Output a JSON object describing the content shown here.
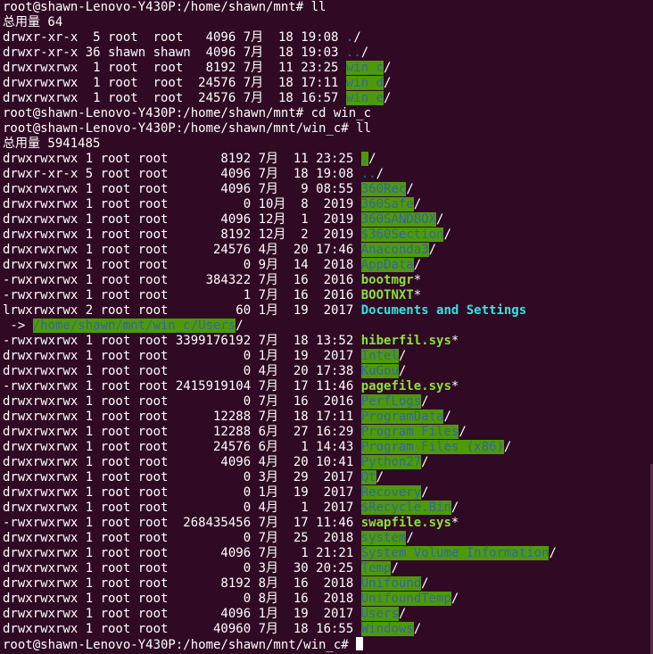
{
  "terminal": {
    "prompt1": "root@shawn-Lenovo-Y430P:/home/shawn/mnt# ll",
    "total1": "总用量 64",
    "mnt_entries": [
      {
        "meta": "drwxr-xr-x  5 root  root   4096 7月  18 19:08 ",
        "name": ".",
        "suffix": "/",
        "style": "dirblue"
      },
      {
        "meta": "drwxr-xr-x 36 shawn shawn  4096 7月  18 19:03 ",
        "name": "..",
        "suffix": "/",
        "style": "dirblue"
      },
      {
        "meta": "drwxrwxrwx  1 root  root   8192 7月  11 23:25 ",
        "name": "win_c",
        "suffix": "/",
        "style": "bg-green"
      },
      {
        "meta": "drwxrwxrwx  1 root  root  24576 7月  18 17:11 ",
        "name": "win_d",
        "suffix": "/",
        "style": "bg-green"
      },
      {
        "meta": "drwxrwxrwx  1 root  root  24576 7月  18 16:57 ",
        "name": "win_e",
        "suffix": "/",
        "style": "bg-green"
      }
    ],
    "prompt2": "root@shawn-Lenovo-Y430P:/home/shawn/mnt# cd win_c",
    "prompt3": "root@shawn-Lenovo-Y430P:/home/shawn/mnt/win_c# ll",
    "total2": "总用量 5941485",
    "winc_entries": [
      {
        "meta": "drwxrwxrwx 1 root root       8192 7月  11 23:25 ",
        "name": ".",
        "suffix": "/",
        "style": "bg-green"
      },
      {
        "meta": "drwxr-xr-x 5 root root       4096 7月  18 19:08 ",
        "name": "..",
        "suffix": "/",
        "style": "dirblue"
      },
      {
        "meta": "drwxrwxrwx 1 root root       4096 7月   9 08:55 ",
        "name": "360Rec",
        "suffix": "/",
        "style": "bg-green"
      },
      {
        "meta": "drwxrwxrwx 1 root root          0 10月  8  2019 ",
        "name": "360Safe",
        "suffix": "/",
        "style": "bg-green"
      },
      {
        "meta": "drwxrwxrwx 1 root root       4096 12月  1  2019 ",
        "name": "360SANDBOX",
        "suffix": "/",
        "style": "bg-green"
      },
      {
        "meta": "drwxrwxrwx 1 root root       8192 12月  2  2019 ",
        "name": "$360Section",
        "suffix": "/",
        "style": "bg-green"
      },
      {
        "meta": "drwxrwxrwx 1 root root      24576 4月  20 17:46 ",
        "name": "Anaconda3",
        "suffix": "/",
        "style": "bg-green"
      },
      {
        "meta": "drwxrwxrwx 1 root root          0 9月  14  2018 ",
        "name": "AppData",
        "suffix": "/",
        "style": "bg-green"
      },
      {
        "meta": "-rwxrwxrwx 1 root root     384322 7月  16  2016 ",
        "name": "bootmgr",
        "suffix": "*",
        "style": "exec"
      },
      {
        "meta": "-rwxrwxrwx 1 root root          1 7月  16  2016 ",
        "name": "BOOTNXT",
        "suffix": "*",
        "style": "exec"
      }
    ],
    "link_entry": {
      "meta": "lrwxrwxrwx 2 root root         60 1月  19  2017 ",
      "name": "Documents and Settings",
      "arrow": " -> ",
      "target": "/home/shawn/mnt/win_c/Users",
      "suffix": "/"
    },
    "winc_entries2": [
      {
        "meta": "-rwxrwxrwx 1 root root 3399176192 7月  18 13:52 ",
        "name": "hiberfil.sys",
        "suffix": "*",
        "style": "exec"
      },
      {
        "meta": "drwxrwxrwx 1 root root          0 1月  19  2017 ",
        "name": "Intel",
        "suffix": "/",
        "style": "bg-green"
      },
      {
        "meta": "drwxrwxrwx 1 root root          0 4月  20 17:38 ",
        "name": "KuGou",
        "suffix": "/",
        "style": "bg-green"
      },
      {
        "meta": "-rwxrwxrwx 1 root root 2415919104 7月  17 11:46 ",
        "name": "pagefile.sys",
        "suffix": "*",
        "style": "exec"
      },
      {
        "meta": "drwxrwxrwx 1 root root          0 7月  16  2016 ",
        "name": "PerfLogs",
        "suffix": "/",
        "style": "bg-green"
      },
      {
        "meta": "drwxrwxrwx 1 root root      12288 7月  18 17:11 ",
        "name": "ProgramData",
        "suffix": "/",
        "style": "bg-green"
      },
      {
        "meta": "drwxrwxrwx 1 root root      12288 6月  27 16:29 ",
        "name": "Program Files",
        "suffix": "/",
        "style": "bg-green"
      },
      {
        "meta": "drwxrwxrwx 1 root root      24576 6月   1 14:43 ",
        "name": "Program Files (x86)",
        "suffix": "/",
        "style": "bg-green"
      },
      {
        "meta": "drwxrwxrwx 1 root root       4096 4月  20 10:41 ",
        "name": "Python27",
        "suffix": "/",
        "style": "bg-green"
      },
      {
        "meta": "drwxrwxrwx 1 root root          0 3月  29  2017 ",
        "name": "Qt",
        "suffix": "/",
        "style": "bg-green"
      },
      {
        "meta": "drwxrwxrwx 1 root root          0 1月  19  2017 ",
        "name": "Recovery",
        "suffix": "/",
        "style": "bg-green"
      },
      {
        "meta": "drwxrwxrwx 1 root root          0 4月   1  2017 ",
        "name": "$Recycle.Bin",
        "suffix": "/",
        "style": "bg-green"
      },
      {
        "meta": "-rwxrwxrwx 1 root root  268435456 7月  17 11:46 ",
        "name": "swapfile.sys",
        "suffix": "*",
        "style": "exec"
      },
      {
        "meta": "drwxrwxrwx 1 root root          0 7月  25  2018 ",
        "name": "system",
        "suffix": "/",
        "style": "bg-green"
      },
      {
        "meta": "drwxrwxrwx 1 root root       4096 7月   1 21:21 ",
        "name": "System Volume Information",
        "suffix": "/",
        "style": "bg-green"
      },
      {
        "meta": "drwxrwxrwx 1 root root          0 3月  30 20:25 ",
        "name": "Temp",
        "suffix": "/",
        "style": "bg-green"
      },
      {
        "meta": "drwxrwxrwx 1 root root       8192 8月  16  2018 ",
        "name": "Unifound",
        "suffix": "/",
        "style": "bg-green"
      },
      {
        "meta": "drwxrwxrwx 1 root root          0 8月  16  2018 ",
        "name": "UnifoundTemp",
        "suffix": "/",
        "style": "bg-green"
      },
      {
        "meta": "drwxrwxrwx 1 root root       4096 1月  19  2017 ",
        "name": "Users",
        "suffix": "/",
        "style": "bg-green"
      },
      {
        "meta": "drwxrwxrwx 1 root root      40960 7月  18 16:55 ",
        "name": "Windows",
        "suffix": "/",
        "style": "bg-green"
      }
    ],
    "prompt4": "root@shawn-Lenovo-Y430P:/home/shawn/mnt/win_c# "
  },
  "colors": {
    "background": "#300a24",
    "dir_highlight_bg": "#4e9a06",
    "dir_text": "#3465a4",
    "exec_text": "#8ae234",
    "link_text": "#34e2e2"
  }
}
